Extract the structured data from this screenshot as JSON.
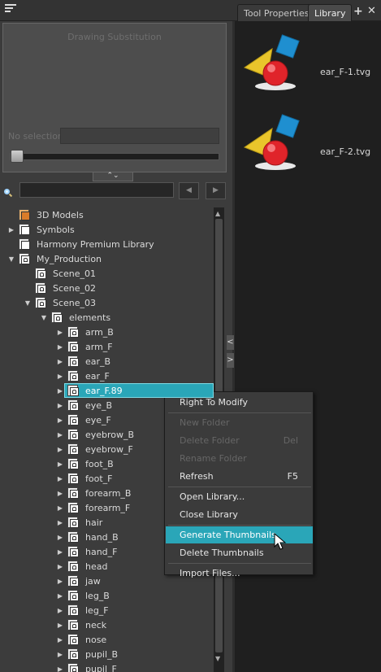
{
  "tabs": [
    {
      "label": "Tool Properties",
      "active": false
    },
    {
      "label": "Library",
      "active": true
    }
  ],
  "substitution": {
    "title": "Drawing Substitution",
    "no_selection_label": "No selection",
    "slider_value": 0
  },
  "tree": [
    {
      "label": "3D Models",
      "depth": 0,
      "expand": "none",
      "icon": "3d-models-folder-icon",
      "selected": false
    },
    {
      "label": "Symbols",
      "depth": 0,
      "expand": "collapsed",
      "icon": "symbols-folder-icon",
      "selected": false
    },
    {
      "label": "Harmony Premium Library",
      "depth": 0,
      "expand": "none",
      "icon": "library-folder-icon",
      "selected": false
    },
    {
      "label": "My_Production",
      "depth": 0,
      "expand": "expanded",
      "icon": "locked-folder-icon",
      "selected": false
    },
    {
      "label": "Scene_01",
      "depth": 1,
      "expand": "none",
      "icon": "locked-folder-icon",
      "selected": false
    },
    {
      "label": "Scene_02",
      "depth": 1,
      "expand": "none",
      "icon": "locked-folder-icon",
      "selected": false
    },
    {
      "label": "Scene_03",
      "depth": 1,
      "expand": "expanded",
      "icon": "locked-folder-icon",
      "selected": false
    },
    {
      "label": "elements",
      "depth": 2,
      "expand": "expanded",
      "icon": "locked-folder-icon",
      "selected": false
    },
    {
      "label": "arm_B",
      "depth": 3,
      "expand": "collapsed",
      "icon": "locked-folder-icon",
      "selected": false
    },
    {
      "label": "arm_F",
      "depth": 3,
      "expand": "collapsed",
      "icon": "locked-folder-icon",
      "selected": false
    },
    {
      "label": "ear_B",
      "depth": 3,
      "expand": "collapsed",
      "icon": "locked-folder-icon",
      "selected": false
    },
    {
      "label": "ear_F",
      "depth": 3,
      "expand": "collapsed",
      "icon": "locked-folder-icon",
      "selected": false
    },
    {
      "label": "ear_F.89",
      "depth": 3,
      "expand": "collapsed",
      "icon": "locked-folder-icon",
      "selected": true
    },
    {
      "label": "eye_B",
      "depth": 3,
      "expand": "collapsed",
      "icon": "locked-folder-icon",
      "selected": false
    },
    {
      "label": "eye_F",
      "depth": 3,
      "expand": "collapsed",
      "icon": "locked-folder-icon",
      "selected": false
    },
    {
      "label": "eyebrow_B",
      "depth": 3,
      "expand": "collapsed",
      "icon": "locked-folder-icon",
      "selected": false
    },
    {
      "label": "eyebrow_F",
      "depth": 3,
      "expand": "collapsed",
      "icon": "locked-folder-icon",
      "selected": false
    },
    {
      "label": "foot_B",
      "depth": 3,
      "expand": "collapsed",
      "icon": "locked-folder-icon",
      "selected": false
    },
    {
      "label": "foot_F",
      "depth": 3,
      "expand": "collapsed",
      "icon": "locked-folder-icon",
      "selected": false
    },
    {
      "label": "forearm_B",
      "depth": 3,
      "expand": "collapsed",
      "icon": "locked-folder-icon",
      "selected": false
    },
    {
      "label": "forearm_F",
      "depth": 3,
      "expand": "collapsed",
      "icon": "locked-folder-icon",
      "selected": false
    },
    {
      "label": "hair",
      "depth": 3,
      "expand": "collapsed",
      "icon": "locked-folder-icon",
      "selected": false
    },
    {
      "label": "hand_B",
      "depth": 3,
      "expand": "collapsed",
      "icon": "locked-folder-icon",
      "selected": false
    },
    {
      "label": "hand_F",
      "depth": 3,
      "expand": "collapsed",
      "icon": "locked-folder-icon",
      "selected": false
    },
    {
      "label": "head",
      "depth": 3,
      "expand": "collapsed",
      "icon": "locked-folder-icon",
      "selected": false
    },
    {
      "label": "jaw",
      "depth": 3,
      "expand": "collapsed",
      "icon": "locked-folder-icon",
      "selected": false
    },
    {
      "label": "leg_B",
      "depth": 3,
      "expand": "collapsed",
      "icon": "locked-folder-icon",
      "selected": false
    },
    {
      "label": "leg_F",
      "depth": 3,
      "expand": "collapsed",
      "icon": "locked-folder-icon",
      "selected": false
    },
    {
      "label": "neck",
      "depth": 3,
      "expand": "collapsed",
      "icon": "locked-folder-icon",
      "selected": false
    },
    {
      "label": "nose",
      "depth": 3,
      "expand": "collapsed",
      "icon": "locked-folder-icon",
      "selected": false
    },
    {
      "label": "pupil_B",
      "depth": 3,
      "expand": "collapsed",
      "icon": "locked-folder-icon",
      "selected": false
    },
    {
      "label": "pupil_F",
      "depth": 3,
      "expand": "collapsed",
      "icon": "locked-folder-icon",
      "selected": false
    }
  ],
  "thumbnails": [
    {
      "name": "ear_F-1.tvg"
    },
    {
      "name": "ear_F-2.tvg"
    }
  ],
  "context_menu": [
    {
      "label": "Right To Modify",
      "shortcut": "",
      "enabled": true,
      "highlighted": false
    },
    {
      "separator": true
    },
    {
      "label": "New Folder",
      "shortcut": "",
      "enabled": false,
      "highlighted": false
    },
    {
      "label": "Delete Folder",
      "shortcut": "Del",
      "enabled": false,
      "highlighted": false
    },
    {
      "label": "Rename Folder",
      "shortcut": "",
      "enabled": false,
      "highlighted": false
    },
    {
      "label": "Refresh",
      "shortcut": "F5",
      "enabled": true,
      "highlighted": false
    },
    {
      "separator": true
    },
    {
      "label": "Open Library...",
      "shortcut": "",
      "enabled": true,
      "highlighted": false
    },
    {
      "label": "Close Library",
      "shortcut": "",
      "enabled": true,
      "highlighted": false
    },
    {
      "separator": true
    },
    {
      "label": "Generate Thumbnails",
      "shortcut": "",
      "enabled": true,
      "highlighted": true
    },
    {
      "label": "Delete Thumbnails",
      "shortcut": "",
      "enabled": true,
      "highlighted": false
    },
    {
      "separator": true
    },
    {
      "label": "Import Files...",
      "shortcut": "",
      "enabled": true,
      "highlighted": false
    }
  ],
  "colors": {
    "accent": "#2aa6b8"
  }
}
